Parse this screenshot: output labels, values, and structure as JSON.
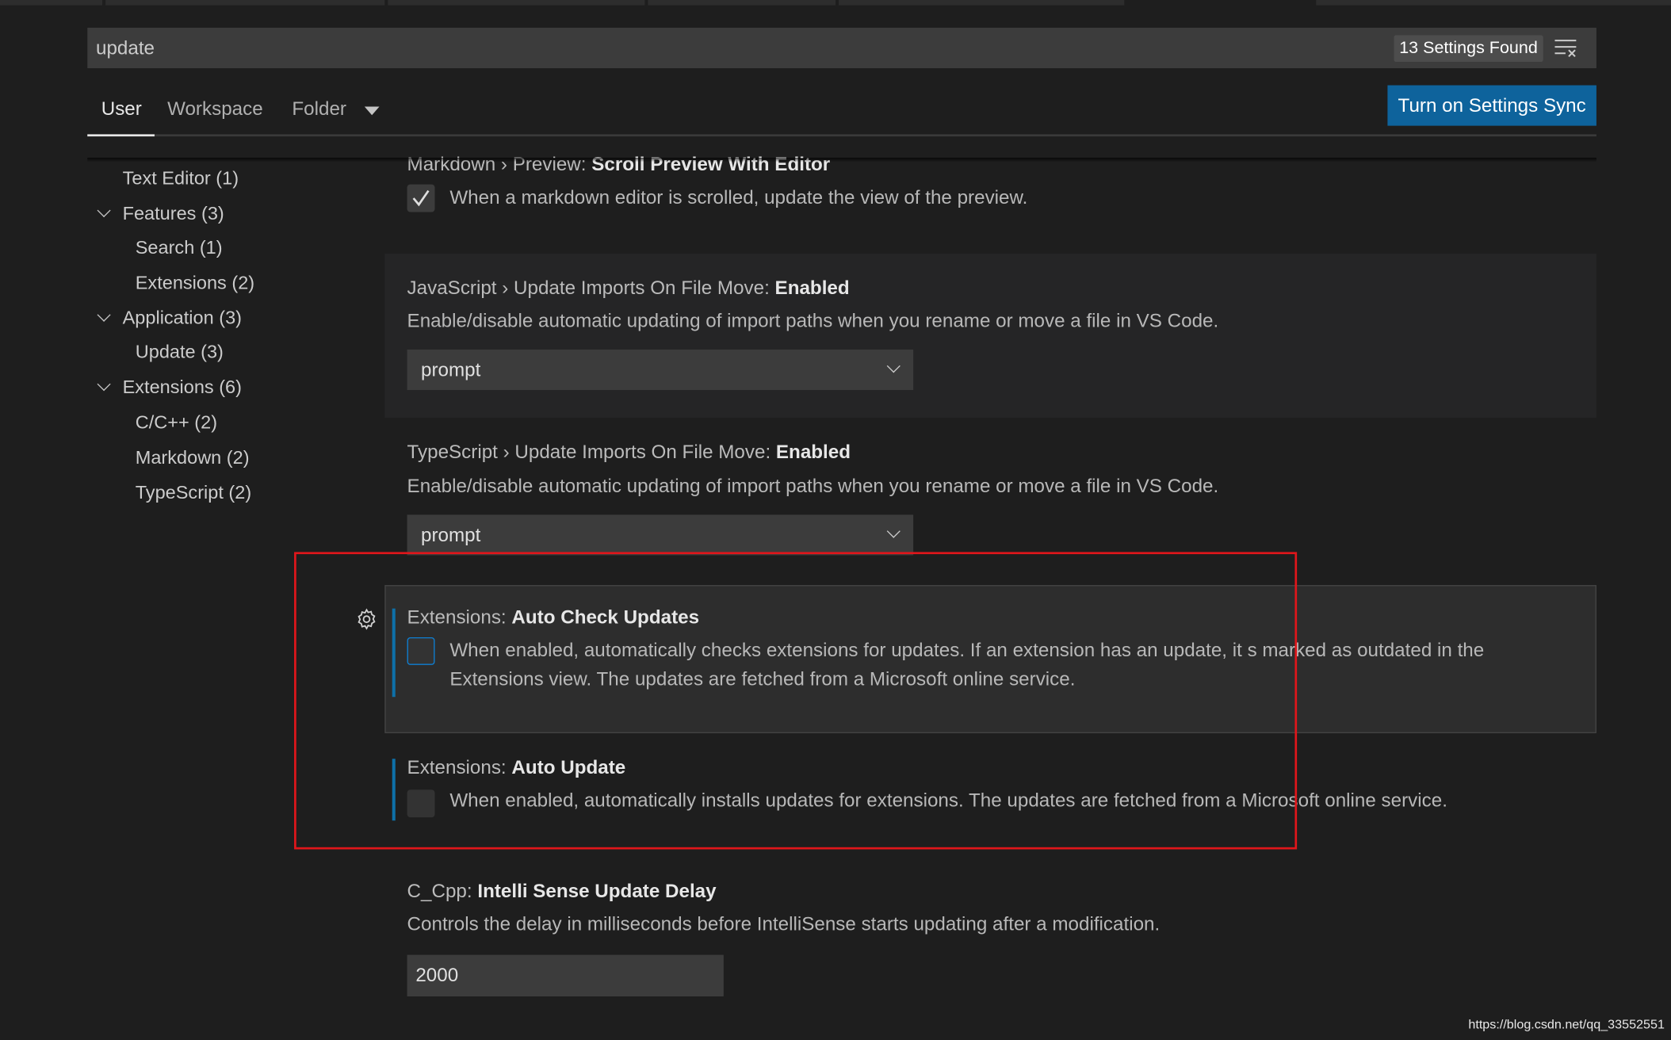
{
  "search": {
    "value": "update",
    "results_badge": "13 Settings Found",
    "clear_icon": "clear-filter-icon"
  },
  "tabs": [
    {
      "label": "User",
      "active": true
    },
    {
      "label": "Workspace"
    },
    {
      "label": "Folder"
    }
  ],
  "sync_button": "Turn on Settings Sync",
  "toc": [
    {
      "label": "Text Editor (1)",
      "level": 0
    },
    {
      "label": "Features (3)",
      "level": 0,
      "expanded": true
    },
    {
      "label": "Search (1)",
      "level": 1
    },
    {
      "label": "Extensions (2)",
      "level": 1
    },
    {
      "label": "Application (3)",
      "level": 0,
      "expanded": true
    },
    {
      "label": "Update (3)",
      "level": 1
    },
    {
      "label": "Extensions (6)",
      "level": 0,
      "expanded": true
    },
    {
      "label": "C/C++ (2)",
      "level": 1
    },
    {
      "label": "Markdown (2)",
      "level": 1
    },
    {
      "label": "TypeScript (2)",
      "level": 1
    }
  ],
  "settings": [
    {
      "category": "Markdown › Preview: ",
      "name": "Scroll Preview With Editor",
      "description": "When a markdown editor is scrolled, update the view of the preview.",
      "checked": true
    },
    {
      "category": "JavaScript › Update Imports On File Move: ",
      "name": "Enabled",
      "description": "Enable/disable automatic updating of import paths when you rename or move a file in VS Code.",
      "value": "prompt"
    },
    {
      "category": "TypeScript › Update Imports On File Move: ",
      "name": "Enabled",
      "description": "Enable/disable automatic updating of import paths when you rename or move a file in VS Code.",
      "value": "prompt"
    },
    {
      "category": "Extensions: ",
      "name": "Auto Check Updates",
      "description_line1": "When enabled, automatically checks extensions for updates. If an extension has an update, it s marked as outdated in the",
      "description_line2": "Extensions view. The updates are fetched from a Microsoft online service.",
      "checked": false
    },
    {
      "category": "Extensions: ",
      "name": "Auto Update",
      "description": "When enabled, automatically installs updates for extensions. The updates are fetched from a Microsoft online service.",
      "checked": false
    },
    {
      "category": "C_Cpp: ",
      "name": "Intelli Sense Update Delay",
      "description": "Controls the delay in milliseconds before IntelliSense starts updating after a modification.",
      "value": "2000"
    }
  ],
  "colors": {
    "accent": "#0e639c",
    "highlight_box": "#e0161b",
    "modified_bar": "#0e70a8"
  },
  "watermark": "https://blog.csdn.net/qq_33552551"
}
